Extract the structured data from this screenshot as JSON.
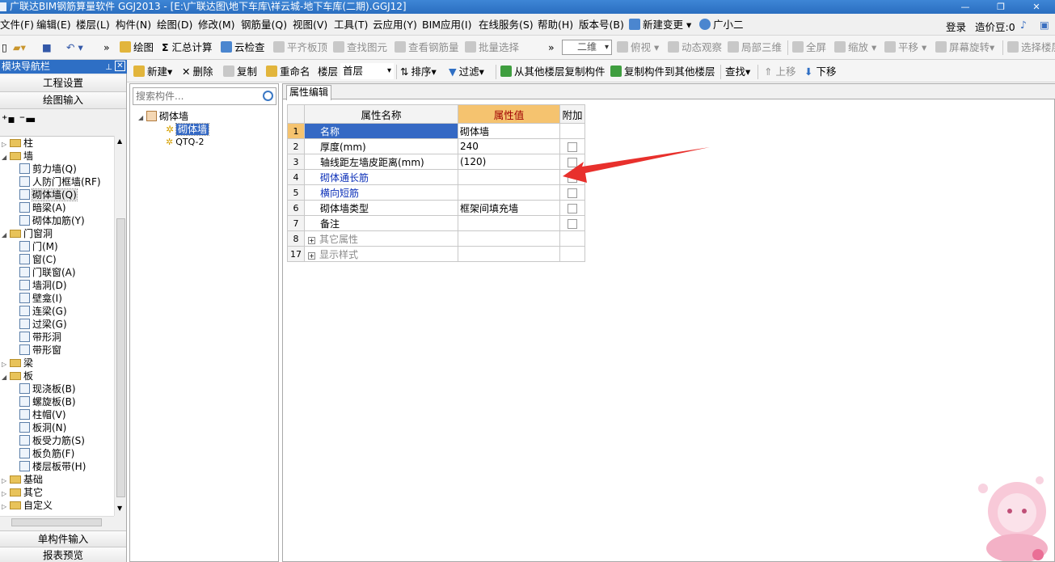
{
  "window": {
    "title": "广联达BIM钢筋算量软件 GGJ2013 - [E:\\广联达图\\地下车库\\祥云城-地下车库(二期).GGJ12]"
  },
  "menu": {
    "items": [
      "文件(F)",
      "编辑(E)",
      "楼层(L)",
      "构件(N)",
      "绘图(D)",
      "修改(M)",
      "钢筋量(Q)",
      "视图(V)",
      "工具(T)",
      "云应用(Y)",
      "BIM应用(I)",
      "在线服务(S)",
      "帮助(H)",
      "版本号(B)"
    ],
    "new_change": "新建变更",
    "user": "广小二",
    "login": "登录",
    "beans": "造价豆:0"
  },
  "toolbar1": {
    "draw": "绘图",
    "calc": "汇总计算",
    "cloud_check": "云检查",
    "flat_top": "平齐板顶",
    "find_elem": "查找图元",
    "view_rebar": "查看钢筋量",
    "batch_select": "批量选择",
    "view_mode": "二维",
    "top_view": "俯视",
    "dynamic_view": "动态观察",
    "local_3d": "局部三维",
    "fullscreen": "全屏",
    "zoom": "缩放",
    "pan": "平移",
    "rotate": "屏幕旋转",
    "select_floor": "选择楼层"
  },
  "nav": {
    "title": "模块导航栏",
    "btn_project": "工程设置",
    "btn_draw": "绘图输入",
    "btn_single": "单构件输入",
    "btn_report": "报表预览",
    "tree": [
      {
        "label": "柱",
        "level": 0,
        "icon": "folder-icon",
        "toggle": "▷"
      },
      {
        "label": "墙",
        "level": 0,
        "icon": "folder-icon",
        "toggle": "◢"
      },
      {
        "label": "剪力墙(Q)",
        "level": 1,
        "icon": "shear-wall-icon"
      },
      {
        "label": "人防门框墙(RF)",
        "level": 1,
        "icon": "door-frame-wall-icon"
      },
      {
        "label": "砌体墙(Q)",
        "level": 1,
        "icon": "masonry-wall-icon",
        "selected": true
      },
      {
        "label": "暗梁(A)",
        "level": 1,
        "icon": "hidden-beam-icon"
      },
      {
        "label": "砌体加筋(Y)",
        "level": 1,
        "icon": "masonry-rebar-icon"
      },
      {
        "label": "门窗洞",
        "level": 0,
        "icon": "folder-icon",
        "toggle": "◢"
      },
      {
        "label": "门(M)",
        "level": 1,
        "icon": "door-icon"
      },
      {
        "label": "窗(C)",
        "level": 1,
        "icon": "window-icon"
      },
      {
        "label": "门联窗(A)",
        "level": 1,
        "icon": "door-window-icon"
      },
      {
        "label": "墙洞(D)",
        "level": 1,
        "icon": "wall-hole-icon"
      },
      {
        "label": "壁龛(I)",
        "level": 1,
        "icon": "niche-icon"
      },
      {
        "label": "连梁(G)",
        "level": 1,
        "icon": "link-beam-icon"
      },
      {
        "label": "过梁(G)",
        "level": 1,
        "icon": "lintel-icon"
      },
      {
        "label": "带形洞",
        "level": 1,
        "icon": "strip-hole-icon"
      },
      {
        "label": "带形窗",
        "level": 1,
        "icon": "strip-window-icon"
      },
      {
        "label": "梁",
        "level": 0,
        "icon": "folder-icon",
        "toggle": "▷"
      },
      {
        "label": "板",
        "level": 0,
        "icon": "folder-icon",
        "toggle": "◢"
      },
      {
        "label": "现浇板(B)",
        "level": 1,
        "icon": "cast-slab-icon"
      },
      {
        "label": "螺旋板(B)",
        "level": 1,
        "icon": "spiral-slab-icon"
      },
      {
        "label": "柱帽(V)",
        "level": 1,
        "icon": "column-cap-icon"
      },
      {
        "label": "板洞(N)",
        "level": 1,
        "icon": "slab-hole-icon"
      },
      {
        "label": "板受力筋(S)",
        "level": 1,
        "icon": "slab-rebar-icon"
      },
      {
        "label": "板负筋(F)",
        "level": 1,
        "icon": "negative-rebar-icon"
      },
      {
        "label": "楼层板带(H)",
        "level": 1,
        "icon": "floor-strip-icon"
      },
      {
        "label": "基础",
        "level": 0,
        "icon": "folder-icon",
        "toggle": "▷"
      },
      {
        "label": "其它",
        "level": 0,
        "icon": "folder-icon",
        "toggle": "▷"
      },
      {
        "label": "自定义",
        "level": 0,
        "icon": "folder-icon",
        "toggle": "▷"
      }
    ]
  },
  "toolbar2": {
    "new": "新建",
    "delete": "删除",
    "copy": "复制",
    "rename": "重命名",
    "floor_label": "楼层",
    "floor_value": "首层",
    "sort": "排序",
    "filter": "过滤",
    "copy_from_floor": "从其他楼层复制构件",
    "copy_to_floor": "复制构件到其他楼层",
    "find": "查找",
    "move_up": "上移",
    "move_down": "下移"
  },
  "component_tree": {
    "search_placeholder": "搜索构件...",
    "root": "砌体墙",
    "children": [
      "砌体墙",
      "QTQ-2"
    ]
  },
  "properties": {
    "tab": "属性编辑",
    "headers": {
      "name": "属性名称",
      "value": "属性值",
      "extra": "附加"
    },
    "rows": [
      {
        "no": "1",
        "name": "名称",
        "value": "砌体墙",
        "checkbox": false,
        "style": "selected"
      },
      {
        "no": "2",
        "name": "厚度(mm)",
        "value": "240",
        "checkbox": true,
        "style": "normal"
      },
      {
        "no": "3",
        "name": "轴线距左墙皮距离(mm)",
        "value": "(120)",
        "checkbox": true,
        "style": "normal"
      },
      {
        "no": "4",
        "name": "砌体通长筋",
        "value": "",
        "checkbox": true,
        "style": "blue"
      },
      {
        "no": "5",
        "name": "横向短筋",
        "value": "",
        "checkbox": true,
        "style": "blue"
      },
      {
        "no": "6",
        "name": "砌体墙类型",
        "value": "框架间填充墙",
        "checkbox": true,
        "style": "normal"
      },
      {
        "no": "7",
        "name": "备注",
        "value": "",
        "checkbox": true,
        "style": "normal"
      },
      {
        "no": "8",
        "name": "其它属性",
        "value": "",
        "checkbox": false,
        "style": "group"
      },
      {
        "no": "17",
        "name": "显示样式",
        "value": "",
        "checkbox": false,
        "style": "group"
      }
    ]
  },
  "colors": {
    "title_bar": "#2a6ec0",
    "selected_row": "#3569c4",
    "header_value": "#f5c36f",
    "annotation_arrow": "#e8302c"
  }
}
